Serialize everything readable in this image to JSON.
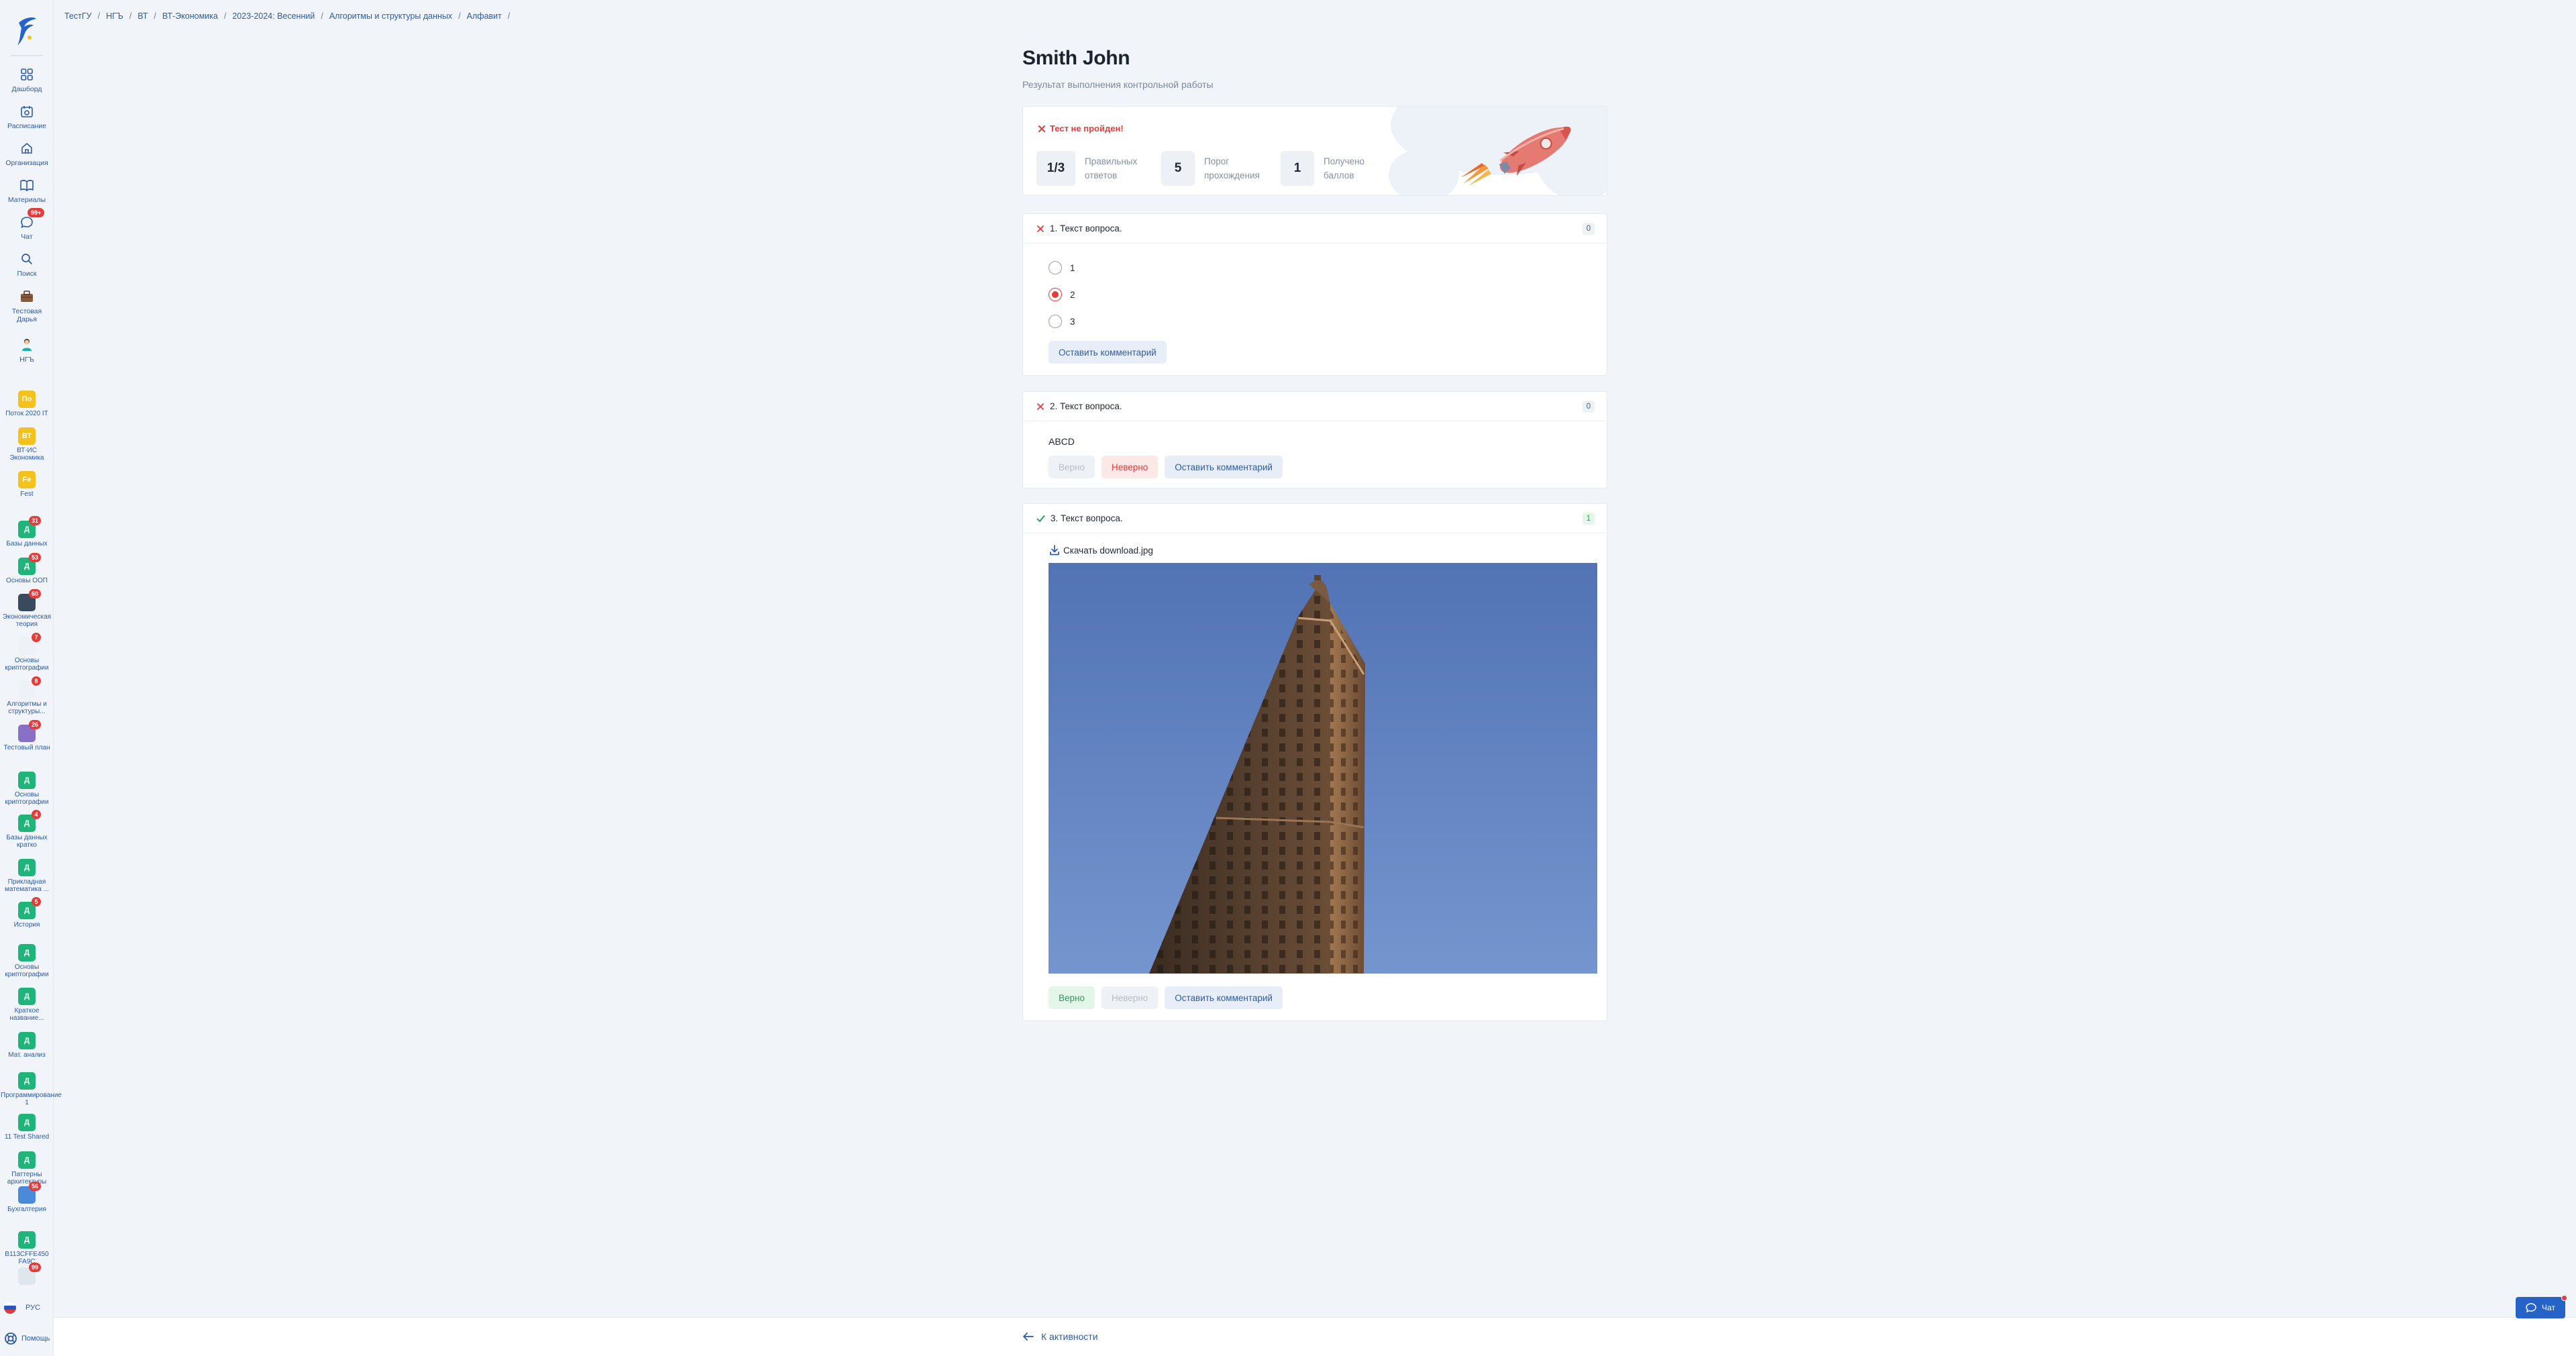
{
  "breadcrumb": [
    "ТестГУ",
    "НГЪ",
    "ВТ",
    "ВТ-Экономика",
    "2023-2024: Весенний",
    "Алгоритмы и структуры данных",
    "Алфавит"
  ],
  "nav": [
    {
      "label": "Дашборд",
      "icon": "dashboard-icon"
    },
    {
      "label": "Расписание",
      "icon": "calendar-icon"
    },
    {
      "label": "Организация",
      "icon": "home-icon"
    },
    {
      "label": "Материалы",
      "icon": "book-icon"
    },
    {
      "label": "Чат",
      "icon": "chat-icon",
      "badge": "99+"
    },
    {
      "label": "Поиск",
      "icon": "search-icon"
    },
    {
      "label": "Тестовая Дарья",
      "icon": "case-icon"
    },
    {
      "label": "НГЪ",
      "icon": "person-icon"
    }
  ],
  "groups": [
    {
      "label": "Поток 2020 IT",
      "letter": "По",
      "color": "#f4c21a"
    },
    {
      "label": "ВТ-ИС Экономика",
      "letter": "ВТ",
      "color": "#f4c21a"
    },
    {
      "label": "Fest",
      "letter": "Fe",
      "color": "#f4c21a"
    },
    {
      "label": "Базы данных",
      "letter": "Д",
      "color": "#1fb57a",
      "badge": "31"
    },
    {
      "label": "Основы ООП",
      "letter": "Д",
      "color": "#1fb57a",
      "badge": "53"
    },
    {
      "label": "Экономическая теория",
      "letter": "",
      "color": "#3a4a5e",
      "badge": "60"
    },
    {
      "label": "Основы криптографии",
      "letter": "",
      "color": "#eef1f5",
      "badge": "7"
    },
    {
      "label": "Алгоритмы и структуры...",
      "letter": "",
      "color": "#eef1f5",
      "badge": "8"
    },
    {
      "label": "Тестовый план",
      "letter": "",
      "color": "#8a6fc7",
      "badge": "26"
    },
    {
      "label": "Основы криптографии",
      "letter": "Д",
      "color": "#1fb57a"
    },
    {
      "label": "Базы данных кратко",
      "letter": "Д",
      "color": "#1fb57a",
      "badge": "4"
    },
    {
      "label": "Прикладная математика ...",
      "letter": "Д",
      "color": "#1fb57a"
    },
    {
      "label": "История",
      "letter": "Д",
      "color": "#1fb57a",
      "badge": "5"
    },
    {
      "label": "Основы криптографии",
      "letter": "Д",
      "color": "#1fb57a"
    },
    {
      "label": "Краткое название...",
      "letter": "Д",
      "color": "#1fb57a"
    },
    {
      "label": "Мат. анализ",
      "letter": "Д",
      "color": "#1fb57a"
    },
    {
      "label": "Программирование 1",
      "letter": "Д",
      "color": "#1fb57a"
    },
    {
      "label": "11 Test Shared",
      "letter": "Д",
      "color": "#1fb57a"
    },
    {
      "label": "Паттерны архитектуры",
      "letter": "Д",
      "color": "#1fb57a"
    },
    {
      "label": "Бухгалтерия",
      "letter": "",
      "color": "#4a8ad8",
      "badge": "56"
    },
    {
      "label": "B113CFFE450 FA9C",
      "letter": "Д",
      "color": "#1fb57a"
    },
    {
      "label": "",
      "letter": "",
      "color": "#dfe7ee",
      "badge": "99"
    }
  ],
  "language": "РУС",
  "help": "Помощь",
  "page": {
    "title": "Smith John",
    "subtitle": "Результат выполнения контрольной работы"
  },
  "summary": {
    "status": "Тест не пройден!",
    "stats": [
      {
        "value": "1/3",
        "caption": "Правильных ответов"
      },
      {
        "value": "5",
        "caption": "Порог прохождения"
      },
      {
        "value": "1",
        "caption": "Получено баллов"
      }
    ]
  },
  "questions": [
    {
      "title": "1. Текст вопроса.",
      "score": "0",
      "options": [
        "1",
        "2",
        "3"
      ],
      "selected": "2",
      "comment_button": "Оставить комментарий"
    },
    {
      "title": "2. Текст вопроса.",
      "score": "0",
      "answer": "ABCD",
      "correct_button": "Верно",
      "wrong_button": "Неверно",
      "comment_button": "Оставить комментарий"
    },
    {
      "title": "3. Текст вопроса.",
      "score": "1",
      "download": "Скачать download.jpg",
      "correct_button": "Верно",
      "wrong_button": "Неверно",
      "comment_button": "Оставить комментарий"
    }
  ],
  "footer": {
    "back": "К активности"
  },
  "chat_fab": "Чат",
  "colors": {
    "accent": "#2d5ba8",
    "error": "#e43b3b",
    "success": "#2e9a57"
  }
}
